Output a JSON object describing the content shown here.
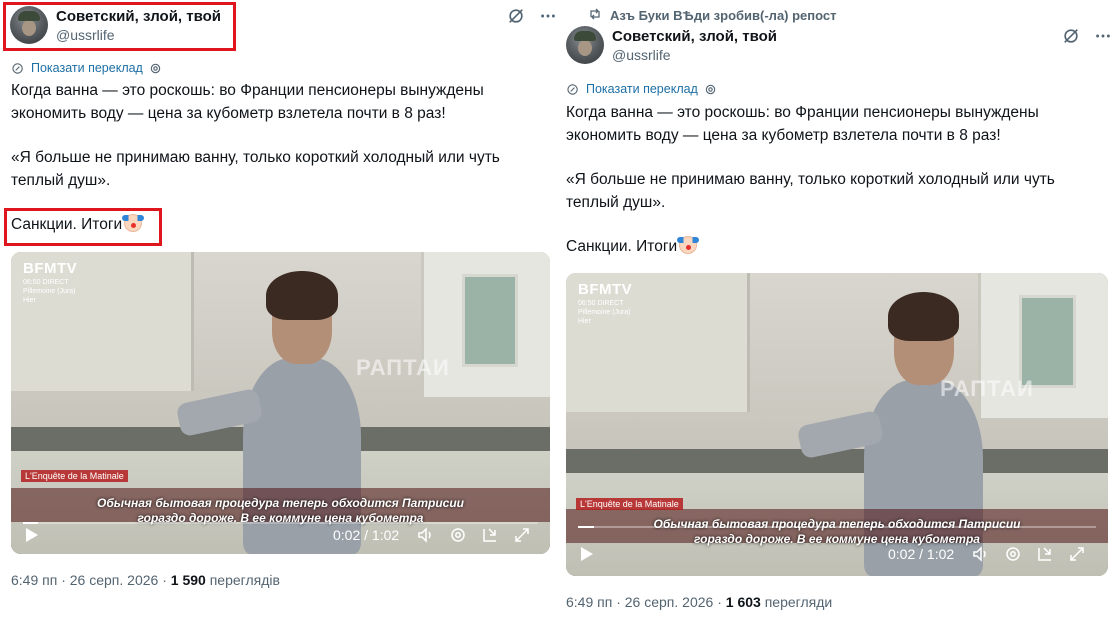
{
  "left": {
    "author": {
      "display_name": "Советский, злой, твой",
      "handle": "@ussrlife"
    },
    "translate_label": "Показати переклад",
    "paragraph1": "Когда ванна — это роскошь: во Франции пенсионеры вынуждены экономить воду — цена за кубометр взлетела почти в 8 раз!",
    "paragraph2": "«Я больше не принимаю ванну, только короткий холодный или чуть теплый душ».",
    "paragraph3": "Санкции. Итоги",
    "video": {
      "channel": "BFMTV",
      "time_overlay": "06:50 DIRECT",
      "location": "Pillemoine (Jura)",
      "when": "Hier",
      "watermark": "РАПТАИ",
      "program": "L'Enquête de la Matinale",
      "subtitle_line1": "Обычная бытовая процедура теперь обходится Патрисии",
      "subtitle_line2": "гораздо дороже. В ее коммуне цена кубометра",
      "timecode": "0:02 / 1:02",
      "progress": 0.03
    },
    "meta": {
      "time": "6:49 пп",
      "date": "26 серп. 2026",
      "views": "1 590",
      "views_label": "переглядів"
    }
  },
  "right": {
    "repost_label": "Азъ Буки ВѢди зробив(-ла) репост",
    "author": {
      "display_name": "Советский, злой, твой",
      "handle": "@ussrlife"
    },
    "translate_label": "Показати переклад",
    "paragraph1": "Когда ванна — это роскошь: во Франции пенсионеры вынуждены экономить воду — цена за кубометр взлетела почти в 8 раз!",
    "paragraph2": "«Я больше не принимаю ванну, только короткий холодный или чуть теплый душ».",
    "paragraph3": "Санкции. Итоги",
    "video": {
      "channel": "BFMTV",
      "time_overlay": "06:50 DIRECT",
      "location": "Pillemoine (Jura)",
      "when": "Hier",
      "watermark": "РАПТАИ",
      "program": "L'Enquête de la Matinale",
      "subtitle_line1": "Обычная бытовая процедура теперь обходится Патрисии",
      "subtitle_line2": "гораздо дороже. В ее коммуне цена кубометра",
      "timecode": "0:02 / 1:02",
      "progress": 0.03
    },
    "meta": {
      "time": "6:49 пп",
      "date": "26 серп. 2026",
      "views": "1 603",
      "views_label": "перегляди"
    }
  },
  "colors": {
    "highlight_box": "#e0161e",
    "link": "#1d6fa5",
    "muted": "#536471"
  },
  "icons": [
    "repost-icon",
    "grok-icon",
    "more-icon",
    "translate-gear-icon",
    "play-icon",
    "volume-icon",
    "settings-icon",
    "pip-icon",
    "fullscreen-icon"
  ]
}
